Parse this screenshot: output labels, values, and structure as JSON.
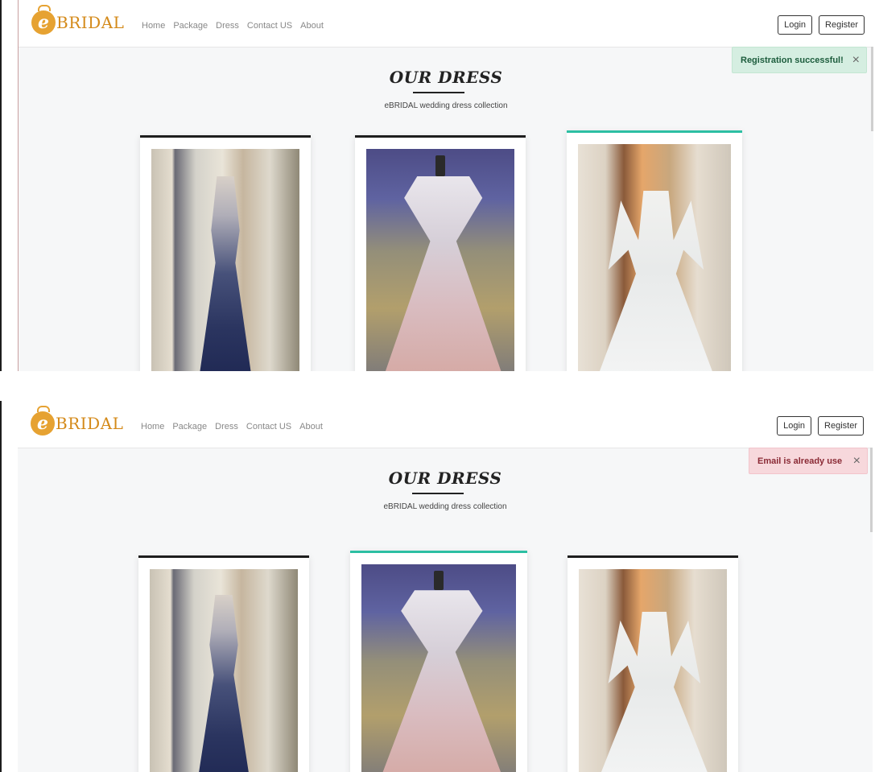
{
  "logo": {
    "mark": "e",
    "text": "BRIDAL"
  },
  "nav": [
    "Home",
    "Package",
    "Dress",
    "Contact US",
    "About"
  ],
  "auth": {
    "login": "Login",
    "register": "Register"
  },
  "section": {
    "title": "OUR DRESS",
    "subtitle": "eBRIDAL wedding dress collection"
  },
  "toasts": {
    "success": {
      "message": "Registration successful!",
      "close": "×"
    },
    "error": {
      "message": "Email is already use",
      "close": "×"
    }
  },
  "colors": {
    "accent": "#2dbfa3",
    "logo": "#d48a1a",
    "success_bg": "#d5eee1",
    "error_bg": "#f7d8dc"
  },
  "dresses": [
    {
      "name": "navy-sequin-gown-icon"
    },
    {
      "name": "blush-off-shoulder-gown-icon"
    },
    {
      "name": "white-long-sleeve-ballgown-icon"
    }
  ]
}
